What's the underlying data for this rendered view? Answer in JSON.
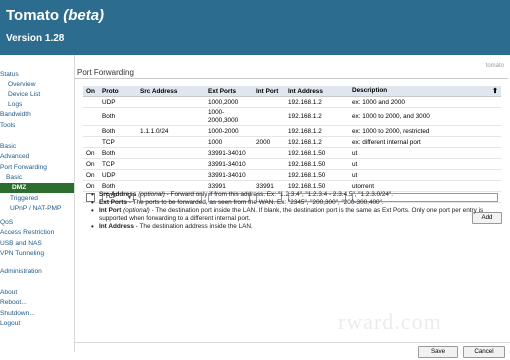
{
  "header": {
    "title": "Tomato (beta)",
    "version": "Version 1.28"
  },
  "brand_tag": "tomato",
  "sidebar": {
    "items": [
      {
        "label": "Status",
        "level": 0
      },
      {
        "label": "Overview",
        "level": 1
      },
      {
        "label": "Device List",
        "level": 1
      },
      {
        "label": "Logs",
        "level": 1
      },
      {
        "label": "Bandwidth",
        "level": 0
      },
      {
        "label": "Tools",
        "level": 0
      },
      {
        "label": "Basic",
        "level": 0
      },
      {
        "label": "Advanced",
        "level": 0
      },
      {
        "label": "Port Forwarding",
        "level": 0
      },
      {
        "label": "Basic",
        "level": 1
      },
      {
        "label": "DMZ",
        "level": 1
      },
      {
        "label": "Triggered",
        "level": 1
      },
      {
        "label": "UPnP / NAT-PMP",
        "level": 1
      },
      {
        "label": "QoS",
        "level": 0
      },
      {
        "label": "Access Restriction",
        "level": 0
      },
      {
        "label": "USB and NAS",
        "level": 0
      },
      {
        "label": "VPN Tunneling",
        "level": 0
      },
      {
        "label": "Administration",
        "level": 0
      },
      {
        "label": "About",
        "level": 0
      },
      {
        "label": "Reboot...",
        "level": 0
      },
      {
        "label": "Shutdown...",
        "level": 0
      },
      {
        "label": "Logout",
        "level": 0
      }
    ],
    "active_label": "DMZ"
  },
  "main": {
    "section_title": "Port Forwarding",
    "table": {
      "headers": [
        "On",
        "Proto",
        "Src Address",
        "Ext Ports",
        "Int Port",
        "Int Address",
        "Description"
      ],
      "rows": [
        {
          "on": "",
          "proto": "UDP",
          "src": "",
          "ext": "1000,2000",
          "int_port": "",
          "int_addr": "192.168.1.2",
          "desc": "ex: 1000 and 2000"
        },
        {
          "on": "",
          "proto": "Both",
          "src": "",
          "ext": "1000-2000,3000",
          "int_port": "",
          "int_addr": "192.168.1.2",
          "desc": "ex: 1000 to 2000, and 3000"
        },
        {
          "on": "",
          "proto": "Both",
          "src": "1.1.1.0/24",
          "ext": "1000-2000",
          "int_port": "",
          "int_addr": "192.168.1.2",
          "desc": "ex: 1000 to 2000, restricted"
        },
        {
          "on": "",
          "proto": "TCP",
          "src": "",
          "ext": "1000",
          "int_port": "2000",
          "int_addr": "192.168.1.2",
          "desc": "ex: different internal port"
        },
        {
          "on": "On",
          "proto": "Both",
          "src": "",
          "ext": "33991-34010",
          "int_port": "",
          "int_addr": "192.168.1.50",
          "desc": "ut"
        },
        {
          "on": "On",
          "proto": "TCP",
          "src": "",
          "ext": "33991-34010",
          "int_port": "",
          "int_addr": "192.168.1.50",
          "desc": "ut"
        },
        {
          "on": "On",
          "proto": "UDP",
          "src": "",
          "ext": "33991-34010",
          "int_port": "",
          "int_addr": "192.168.1.50",
          "desc": "ut"
        },
        {
          "on": "On",
          "proto": "Both",
          "src": "",
          "ext": "33991",
          "int_port": "33991",
          "int_addr": "192.168.1.50",
          "desc": "utorrent"
        }
      ],
      "new_entry": {
        "proto": "TCP"
      }
    },
    "add_label": "Add",
    "notes": [
      {
        "term": "Src Address",
        "qualifier": "(optional)",
        "text": " - Forward only if from this address. Ex: \"1.2.3.4\", \"1.2.3.4 - 2.3.4.5\", \"1.2.3.0/24\"."
      },
      {
        "term": "Ext Ports",
        "qualifier": "",
        "text": " - The ports to be forwarded, as seen from the WAN. Ex: \"2345\", \"200,300\", \"200-300,400\"."
      },
      {
        "term": "Int Port",
        "qualifier": "(optional)",
        "text": " - The destination port inside the LAN. If blank, the destination port is the same as Ext Ports. Only one port per entry is supported when forwarding to a different internal port."
      },
      {
        "term": "Int Address",
        "qualifier": "",
        "text": " - The destination address inside the LAN."
      }
    ]
  },
  "footer": {
    "save_label": "Save",
    "cancel_label": "Cancel"
  },
  "colors": {
    "header_bg": "#2c6c8e",
    "active_nav": "#2b6e2e",
    "link": "#1d5a8a"
  }
}
